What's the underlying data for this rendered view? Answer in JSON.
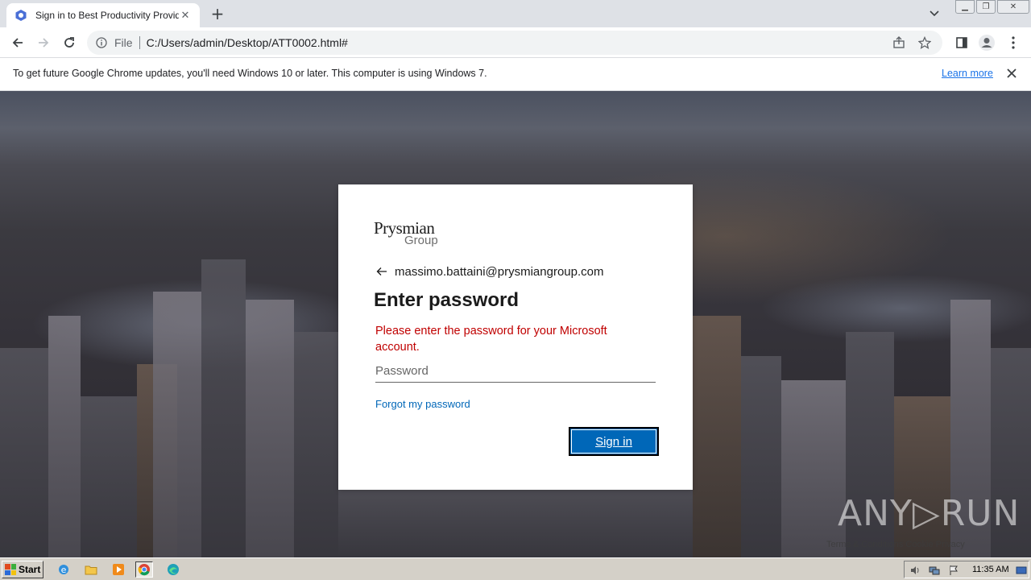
{
  "browser": {
    "tab_title": "Sign in to Best Productivity Provider",
    "url_scheme": "File",
    "url": "C:/Users/admin/Desktop/ATT0002.html#"
  },
  "infobar": {
    "message": "To get future Google Chrome updates, you'll need Windows 10 or later. This computer is using Windows 7.",
    "link": "Learn more"
  },
  "signin": {
    "logo_main": "Prysmian",
    "logo_sub": "Group",
    "email": "massimo.battaini@prysmiangroup.com",
    "title": "Enter password",
    "error": "Please enter the password for your Microsoft account.",
    "password_placeholder": "Password",
    "forgot_link": "Forgot my password",
    "submit_label": "Sign in"
  },
  "watermark": {
    "text": "ANY▷RUN",
    "footer": "Terms & Conditions   Cookie Privacy"
  },
  "taskbar": {
    "start_label": "Start",
    "clock": "11:35 AM"
  },
  "colors": {
    "accent": "#0067b8",
    "error": "#c00000",
    "link": "#1a73e8"
  }
}
